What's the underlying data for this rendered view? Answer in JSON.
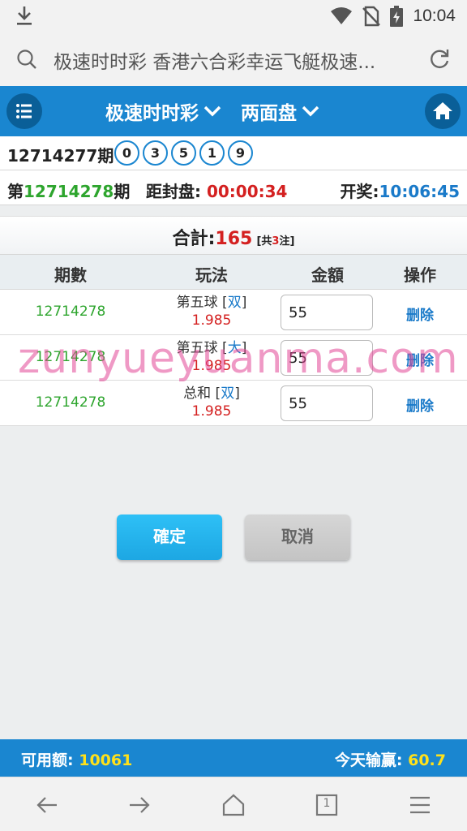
{
  "status_bar": {
    "time": "10:04",
    "icons": [
      "download-icon",
      "wifi-icon",
      "no-sim-icon",
      "battery-icon"
    ]
  },
  "browser": {
    "url_title": "极速时时彩 香港六合彩幸运飞艇极速...",
    "tab_count": "1"
  },
  "header": {
    "game_label": "极速时时彩",
    "market_label": "两面盘"
  },
  "last_draw": {
    "period": "12714277期",
    "balls": [
      "0",
      "3",
      "5",
      "1",
      "9"
    ]
  },
  "current": {
    "prefix": "第",
    "period": "12714278",
    "suffix": "期",
    "countdown_label": "距封盘:",
    "countdown": "00:00:34",
    "open_label": "开奖:",
    "open_time": "10:06:45"
  },
  "summary": {
    "label": "合計:",
    "total": "165",
    "count_prefix": "[共",
    "count": "3",
    "count_suffix": "注]"
  },
  "table": {
    "headers": [
      "期數",
      "玩法",
      "金額",
      "操作"
    ],
    "rows": [
      {
        "period": "12714278",
        "play": "第五球",
        "choice": "双",
        "odds": "1.985",
        "amount": "55",
        "action": "删除"
      },
      {
        "period": "12714278",
        "play": "第五球",
        "choice": "大",
        "odds": "1.985",
        "amount": "55",
        "action": "删除"
      },
      {
        "period": "12714278",
        "play": "总和",
        "choice": "双",
        "odds": "1.985",
        "amount": "55",
        "action": "删除"
      }
    ]
  },
  "watermark": "zunyueyuanma.com",
  "buttons": {
    "confirm": "確定",
    "cancel": "取消"
  },
  "footer": {
    "balance_label": "可用额:",
    "balance": "10061",
    "today_label": "今天输赢:",
    "today": "60.7"
  },
  "colors": {
    "primary": "#1a86d0",
    "win_green": "#2ea52e",
    "alert_red": "#d42020",
    "highlight_yellow": "#ffe11a",
    "confirm_button": "#1da7e3"
  }
}
